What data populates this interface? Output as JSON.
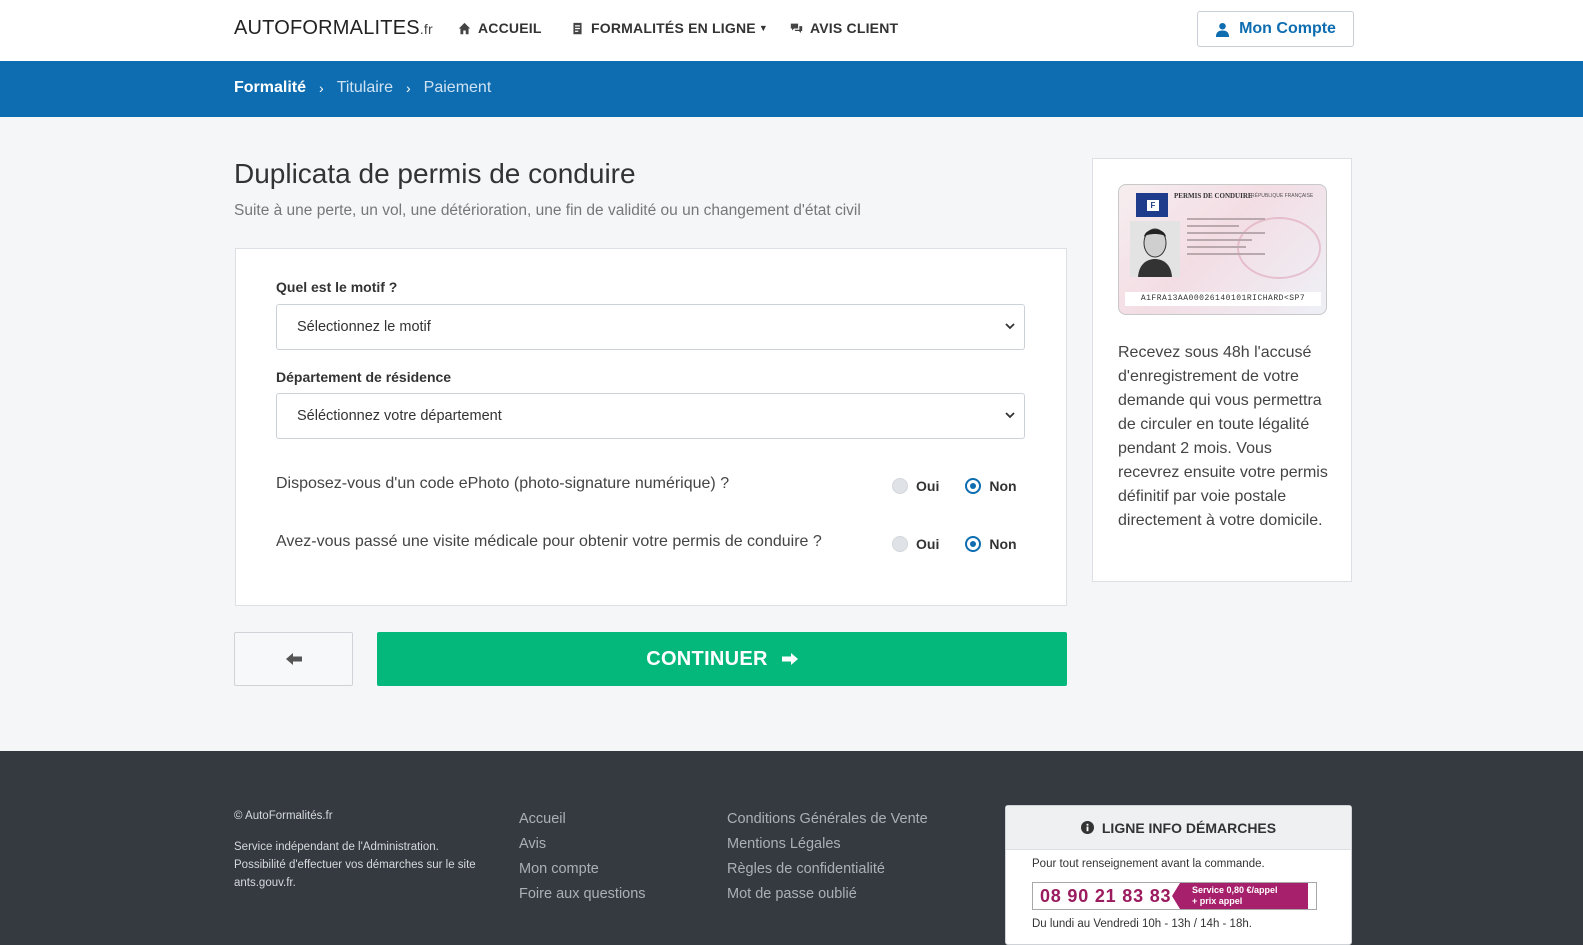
{
  "header": {
    "logo_main": "AUTOFORMALITES",
    "logo_tld": ".fr",
    "nav": [
      {
        "label": "ACCUEIL",
        "icon": "home-icon"
      },
      {
        "label": "FORMALITÉS EN LIGNE",
        "icon": "document-icon"
      },
      {
        "label": "AVIS CLIENT",
        "icon": "comments-icon"
      }
    ],
    "account_label": "Mon Compte"
  },
  "breadcrumb": {
    "steps": [
      "Formalité",
      "Titulaire",
      "Paiement"
    ],
    "separator": "›"
  },
  "main": {
    "title": "Duplicata de permis de conduire",
    "subtitle": "Suite à une perte, un vol, une détérioration, une fin de validité ou un changement d'état civil"
  },
  "form": {
    "motif_label": "Quel est le motif ?",
    "motif_value": "Sélectionnez le motif",
    "departement_label": "Département de résidence",
    "departement_value": "Séléctionnez votre département",
    "q1": {
      "text": "Disposez-vous d'un code ePhoto (photo-signature numérique) ?",
      "yes": "Oui",
      "no": "Non",
      "selected": "no"
    },
    "q2": {
      "text": "Avez-vous passé une visite médicale pour obtenir votre permis de conduire ?",
      "yes": "Oui",
      "no": "Non",
      "selected": "no"
    }
  },
  "buttons": {
    "continue_label": "CONTINUER"
  },
  "side": {
    "license_header": "PERMIS DE CONDUIRE",
    "license_header2": "RÉPUBLIQUE FRANÇAISE",
    "license_country": "F",
    "license_mrz": "A1FRA13AA00026140101RICHARD<SP7",
    "text": "Recevez sous 48h l'accusé d'enregistrement de votre demande qui vous permettra de circuler en toute légalité pendant 2 mois. Vous recevrez ensuite votre permis définitif par voie postale directement à votre domicile."
  },
  "footer": {
    "copyright": "© AutoFormalités.fr",
    "description": "Service indépendant de l'Administration. Possibilité d'effectuer vos démarches sur le site ants.gouv.fr.",
    "col1": [
      "Accueil",
      "Avis",
      "Mon compte",
      "Foire aux questions"
    ],
    "col2": [
      "Conditions Générales de Vente",
      "Mentions Légales",
      "Règles de confidentialité",
      "Mot de passe oublié"
    ],
    "info": {
      "title": "LIGNE INFO DÉMARCHES",
      "line1": "Pour tout renseignement avant la commande.",
      "phone": "08 90 21 83 83",
      "tag1": "Service 0,80 €/appel",
      "tag2": "+ prix appel",
      "hours": "Du lundi au Vendredi 10h - 13h / 14h - 18h."
    }
  },
  "colors": {
    "brand_blue": "#0e6db0",
    "continue_green": "#04b77a",
    "footer_bg": "#343a40",
    "phone_magenta": "#a6206c"
  }
}
